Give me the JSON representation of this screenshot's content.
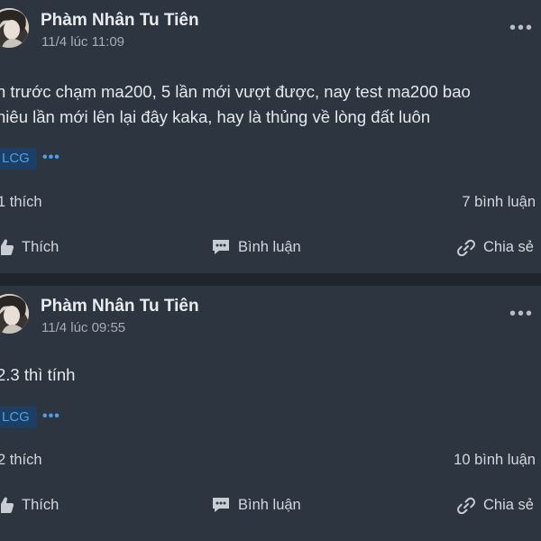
{
  "colors": {
    "page_bg": "#20252d",
    "card_bg": "#2d3541",
    "tag_bg": "#1d3f63",
    "tag_text": "#4aa0ef",
    "muted_text": "#a7adb7"
  },
  "posts": [
    {
      "author": "Phàm Nhân Tu Tiên",
      "time": "11/4 lúc 11:09",
      "more_icon": "more-horizontal-icon",
      "content_lines": [
        "n trước chạm ma200, 5 lần mới vượt được, nay test ma200 bao",
        "hiêu lần mới lên lại đây kaka, hay là thủng về lòng đất luôn"
      ],
      "tag": "LCG",
      "tag_more": "•••",
      "likes": "1 thích",
      "comments": "7 bình luận",
      "actions": {
        "like": "Thích",
        "comment": "Bình luận",
        "share": "Chia sẻ"
      }
    },
    {
      "author": "Phàm Nhân Tu Tiên",
      "time": "11/4 lúc 09:55",
      "more_icon": "more-horizontal-icon",
      "content_lines": [
        "2.3 thì tính"
      ],
      "tag": "LCG",
      "tag_more": "•••",
      "likes": "2 thích",
      "comments": "10 bình luận",
      "actions": {
        "like": "Thích",
        "comment": "Bình luận",
        "share": "Chia sẻ"
      }
    }
  ]
}
